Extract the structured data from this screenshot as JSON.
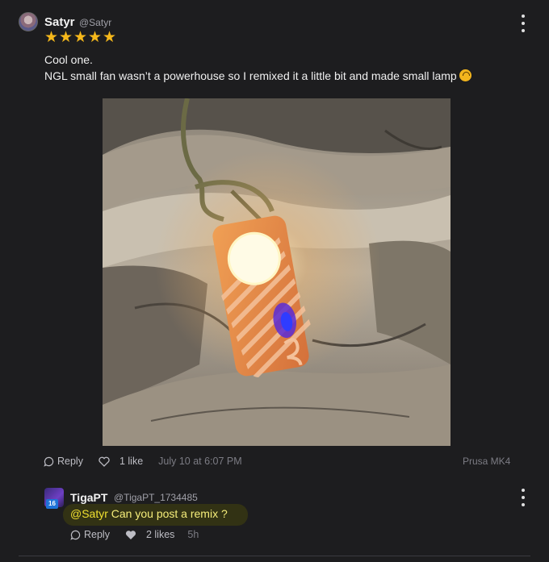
{
  "comment": {
    "author": "Satyr",
    "handle": "@Satyr",
    "rating_stars": 5,
    "line1": "Cool one.",
    "line2": "NGL small fan wasn’t a powerhouse so I remixed it a little bit and made small lamp",
    "reply_label": "Reply",
    "likes_label": "1 like",
    "timestamp": "July 10 at 6:07 PM",
    "printer": "Prusa MK4"
  },
  "reply": {
    "author": "TigaPT",
    "handle": "@TigaPT_1734485",
    "level": "16",
    "mention": "@Satyr",
    "text": "Can you post a remix ?",
    "reply_label": "Reply",
    "likes_label": "2 likes",
    "timestamp": "5h"
  },
  "colors": {
    "background": "#1d1d1f",
    "star": "#f5b81b",
    "mention": "#f0e030",
    "highlight": "#323214"
  }
}
